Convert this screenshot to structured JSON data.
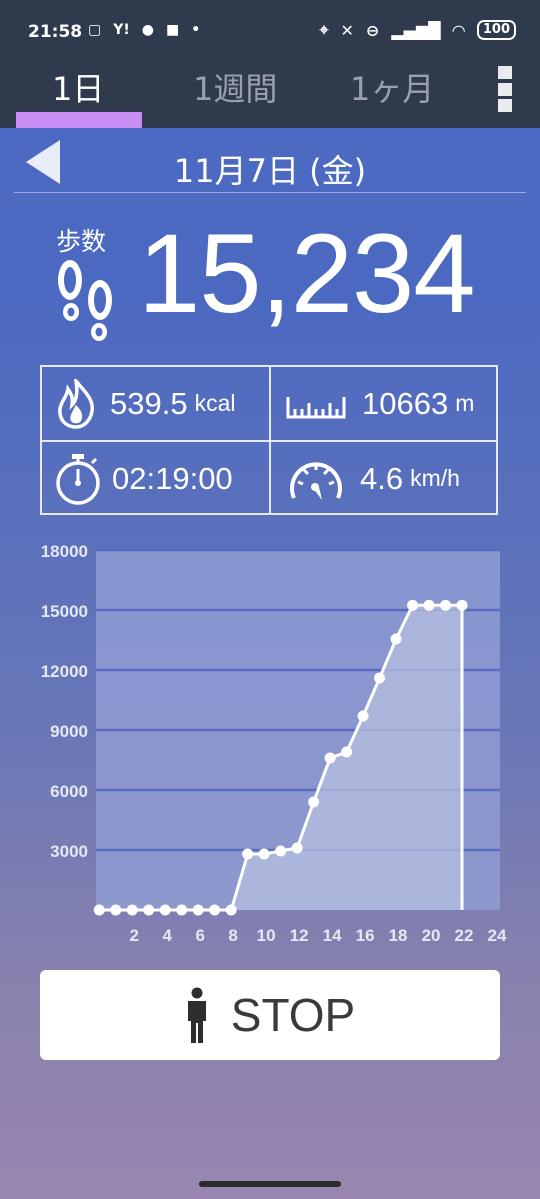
{
  "status_bar": {
    "time": "21:58",
    "left_icons": [
      "screenshot-icon",
      "yahoo-icon",
      "line-icon",
      "square-icon",
      "dot-icon"
    ],
    "right_icons": [
      "location-icon",
      "mute-icon",
      "dnd-icon",
      "signal-icon",
      "wifi-icon"
    ],
    "battery": "100"
  },
  "tabs": [
    {
      "label": "1日",
      "active": true
    },
    {
      "label": "1週間",
      "active": false
    },
    {
      "label": "1ヶ月",
      "active": false
    }
  ],
  "date_header": {
    "date": "11月7日 (金)"
  },
  "steps": {
    "label": "歩数",
    "value": "15,234"
  },
  "stats": {
    "calories": {
      "value": "539.5",
      "unit": "kcal",
      "icon": "flame-icon"
    },
    "distance": {
      "value": "10663",
      "unit": "m",
      "icon": "ruler-icon"
    },
    "duration": {
      "value": "02:19:00",
      "icon": "stopwatch-icon"
    },
    "speed": {
      "value": "4.6",
      "unit": "km/h",
      "icon": "speedometer-icon"
    }
  },
  "chart_data": {
    "type": "area",
    "x": [
      0,
      1,
      2,
      3,
      4,
      5,
      6,
      7,
      8,
      9,
      10,
      11,
      12,
      13,
      14,
      15,
      16,
      17,
      18,
      19,
      20,
      21,
      22
    ],
    "values": [
      0,
      0,
      0,
      0,
      0,
      0,
      0,
      0,
      0,
      2800,
      2800,
      2950,
      3100,
      5400,
      7600,
      7900,
      9700,
      11600,
      13550,
      15234,
      15234,
      15234,
      15234
    ],
    "x_ticks": [
      2,
      4,
      6,
      8,
      10,
      12,
      14,
      16,
      18,
      20,
      22,
      24
    ],
    "y_ticks": [
      3000,
      6000,
      9000,
      12000,
      15000,
      18000
    ],
    "xlim": [
      -0.5,
      24
    ],
    "ylim": [
      0,
      18000
    ],
    "grid": true
  },
  "stop_button": {
    "label": "STOP",
    "icon": "person-icon"
  },
  "colors": {
    "accent": "#c98ef2",
    "topbar": "#2f3a4c",
    "chart_bg": "#8f9cd2",
    "fill": "#b7bfe0"
  }
}
